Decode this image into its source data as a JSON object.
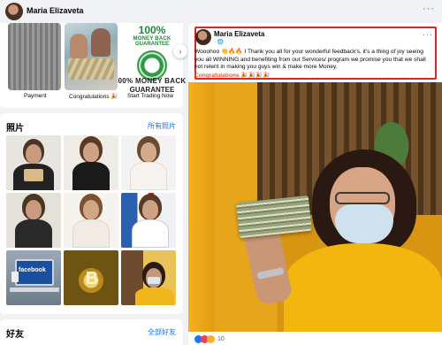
{
  "header": {
    "name": "Maria Elizaveta",
    "more": "···"
  },
  "featured": {
    "cards": [
      {
        "caption": "Payment"
      },
      {
        "caption": "Congratulations 🎉"
      },
      {
        "caption": "Start Trading Now"
      }
    ],
    "guarantee": {
      "pct": "100%",
      "line1": "MONEY BACK",
      "line2": "GUARANTEE",
      "line3": "00% MONEY BACK",
      "line4": "GUARANTEE"
    },
    "next_icon": "›"
  },
  "photos": {
    "title": "照片",
    "see_all": "所有照片",
    "laptop_text": "facebook",
    "coin_text": "B"
  },
  "friends": {
    "title": "好友",
    "see_all": "全部好友"
  },
  "post": {
    "author": "Maria Elizaveta",
    "meta": "· 🌐",
    "more": "···",
    "text": "Wooohoo 👏🔥🔥 I Thank you all for your wonderful feedback's, it's a thing of joy seeing you all WINNING and benefiting from our Services/ program we promise you that we shall not relent in making you guys win & make more Money.",
    "tag": "Congratulations 🎉🎉🎉🎉",
    "reaction_count": "10"
  },
  "colors": {
    "link": "#216fdb",
    "highlight": "#e02424",
    "accent_orange": "#e4572e"
  },
  "icons": {
    "reactions": [
      "like-icon",
      "love-icon",
      "care-icon"
    ]
  }
}
